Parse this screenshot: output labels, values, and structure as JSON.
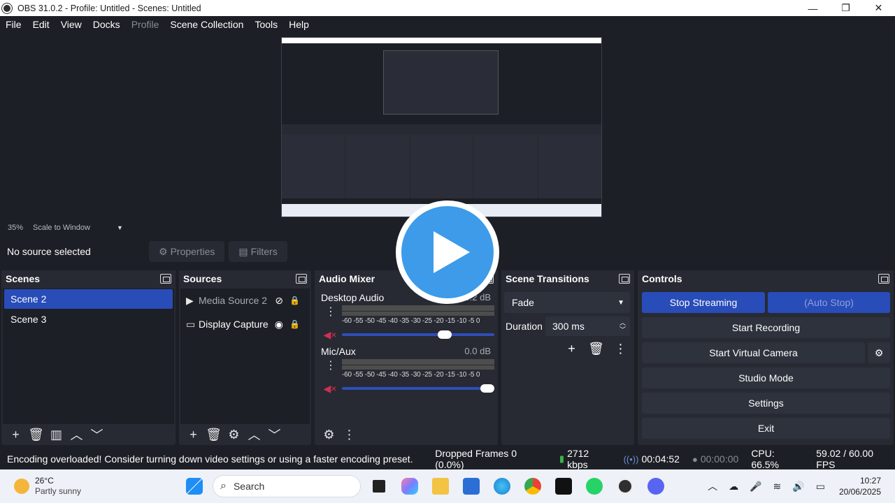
{
  "window": {
    "title": "OBS 31.0.2 - Profile: Untitled - Scenes: Untitled",
    "minimize": "—",
    "maximize": "❐",
    "close": "✕"
  },
  "menu": [
    "File",
    "Edit",
    "View",
    "Docks",
    "Profile",
    "Scene Collection",
    "Tools",
    "Help"
  ],
  "preview": {
    "zoom": "35%",
    "scale_mode": "Scale to Window"
  },
  "context": {
    "no_source": "No source selected",
    "properties": "Properties",
    "filters": "Filters"
  },
  "scenes": {
    "title": "Scenes",
    "items": [
      {
        "label": "Scene 2",
        "active": true
      },
      {
        "label": "Scene 3",
        "active": false
      }
    ]
  },
  "sources": {
    "title": "Sources",
    "items": [
      {
        "label": "Media Source 2",
        "icon": "play-icon",
        "visible": false
      },
      {
        "label": "Display Capture",
        "icon": "monitor-icon",
        "visible": true
      }
    ]
  },
  "mixer": {
    "title": "Audio Mixer",
    "channels": [
      {
        "name": "Desktop Audio",
        "db": "0.2 dB",
        "volume_percent": 70
      },
      {
        "name": "Mic/Aux",
        "db": "0.0 dB",
        "volume_percent": 100
      }
    ],
    "ticks": "-60 -55 -50 -45 -40 -35 -30 -25 -20 -15 -10  -5   0"
  },
  "transitions": {
    "title": "Scene Transitions",
    "selected": "Fade",
    "duration_label": "Duration",
    "duration_value": "300 ms"
  },
  "controls": {
    "title": "Controls",
    "stop_streaming": "Stop Streaming",
    "auto_stop": "(Auto Stop)",
    "start_recording": "Start Recording",
    "start_virtual_camera": "Start Virtual Camera",
    "studio_mode": "Studio Mode",
    "settings": "Settings",
    "exit": "Exit"
  },
  "status": {
    "message": "Encoding overloaded! Consider turning down video settings or using a faster encoding preset.",
    "dropped_frames": "Dropped Frames 0 (0.0%)",
    "bitrate": "2712 kbps",
    "stream_time": "00:04:52",
    "rec_time": "00:00:00",
    "cpu": "CPU: 66.5%",
    "fps": "59.02 / 60.00 FPS"
  },
  "taskbar": {
    "temp": "26°C",
    "weather": "Partly sunny",
    "search_placeholder": "Search",
    "time": "10:27",
    "date": "20/06/2025"
  },
  "colors": {
    "accent": "#284cb8",
    "bg": "#1d1f26",
    "panel": "#272a33"
  }
}
